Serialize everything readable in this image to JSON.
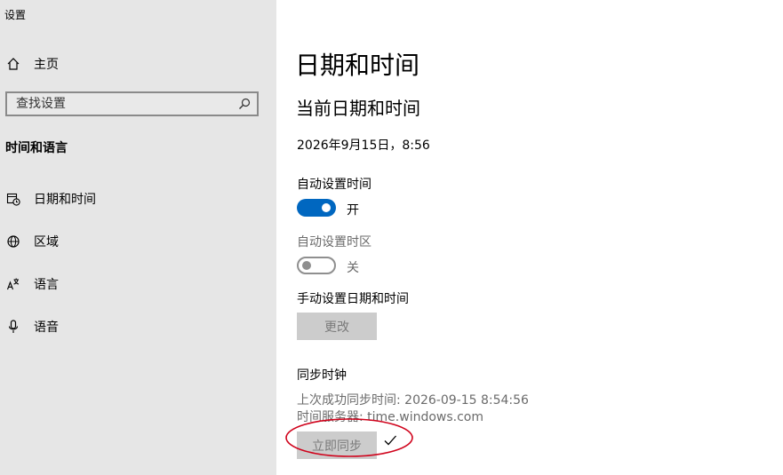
{
  "app": {
    "title": "设置"
  },
  "sidebar": {
    "home_label": "主页",
    "search_placeholder": "查找设置",
    "section_heading": "时间和语言",
    "items": [
      {
        "label": "日期和时间",
        "icon": "calendar-clock-icon"
      },
      {
        "label": "区域",
        "icon": "globe-icon"
      },
      {
        "label": "语言",
        "icon": "language-icon"
      },
      {
        "label": "语音",
        "icon": "microphone-icon"
      }
    ]
  },
  "main": {
    "page_title": "日期和时间",
    "section_title": "当前日期和时间",
    "current_datetime": "2026年9月15日，8:56",
    "auto_time": {
      "label": "自动设置时间",
      "state_label": "开",
      "on": true
    },
    "auto_timezone": {
      "label": "自动设置时区",
      "state_label": "关",
      "on": false,
      "disabled": true
    },
    "manual": {
      "label": "手动设置日期和时间",
      "button_label": "更改",
      "disabled": true
    },
    "sync": {
      "title": "同步时钟",
      "last_sync": "上次成功同步时间: 2026-09-15 8:54:56",
      "time_server": "时间服务器: time.windows.com",
      "button_label": "立即同步",
      "status_icon": "checkmark-icon"
    }
  },
  "colors": {
    "accent": "#0067c0",
    "annotation": "#d0021b",
    "sidebar_bg": "#e6e6e6"
  }
}
